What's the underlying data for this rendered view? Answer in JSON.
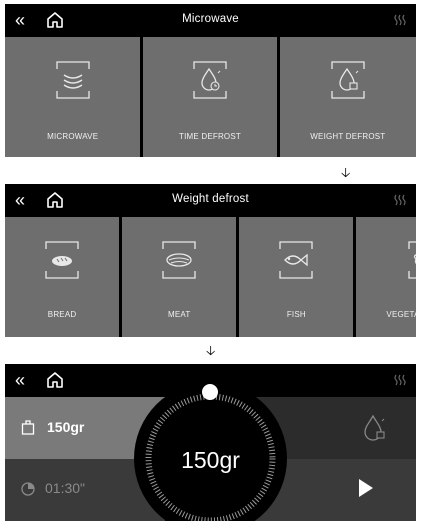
{
  "screen1": {
    "title": "Microwave",
    "tiles": [
      {
        "label": "MICROWAVE",
        "icon": "microwave-waves-icon"
      },
      {
        "label": "TIME DEFROST",
        "icon": "drop-clock-icon"
      },
      {
        "label": "WEIGHT DEFROST",
        "icon": "drop-weight-icon"
      }
    ]
  },
  "screen2": {
    "title": "Weight defrost",
    "tiles": [
      {
        "label": "BREAD",
        "icon": "bread-icon"
      },
      {
        "label": "MEAT",
        "icon": "meat-icon"
      },
      {
        "label": "FISH",
        "icon": "fish-icon"
      },
      {
        "label": "VEGETA",
        "icon": "vegetable-icon"
      }
    ]
  },
  "screen3": {
    "weight": "150gr",
    "time": "01:30\"",
    "dial_value": "150gr"
  },
  "icons": {
    "back": "«",
    "home": "home-icon",
    "heat": "heat-icon",
    "arrow": "down-arrow"
  },
  "arrow_glyph": "🡣",
  "colors": {
    "tile": "#6e6e6e",
    "screen_bg": "#000000",
    "weight_cell": "#7a7a7a",
    "time_cell": "#3a3a3a"
  }
}
